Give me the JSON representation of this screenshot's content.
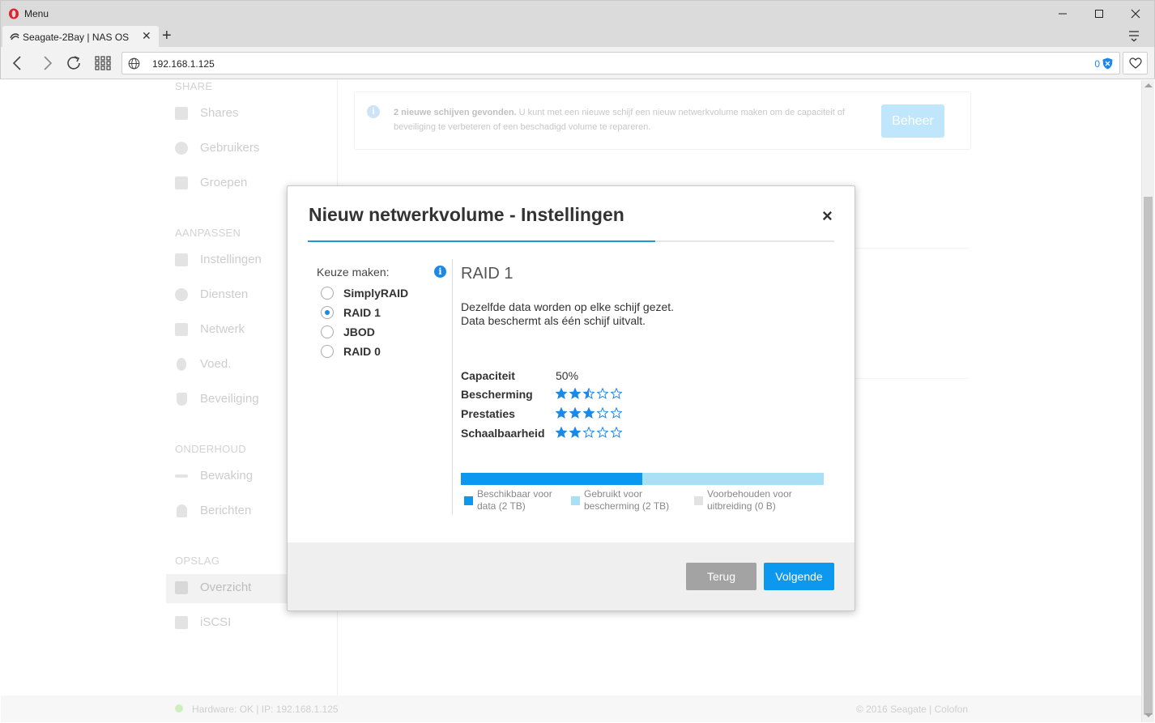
{
  "browser": {
    "menu_label": "Menu",
    "tab_title": "Seagate-2Bay | NAS OS",
    "url": "192.168.1.125",
    "adblock_count": "0"
  },
  "sidebar": {
    "top_section_label": "SHARE",
    "sections": [
      {
        "heading": "",
        "items": [
          {
            "label": "Shares",
            "icon": "folder-icon"
          },
          {
            "label": "Gebruikers",
            "icon": "user-icon"
          },
          {
            "label": "Groepen",
            "icon": "group-icon"
          }
        ]
      },
      {
        "heading": "AANPASSEN",
        "items": [
          {
            "label": "Instellingen",
            "icon": "wrench-icon"
          },
          {
            "label": "Diensten",
            "icon": "gear-icon"
          },
          {
            "label": "Netwerk",
            "icon": "network-icon"
          },
          {
            "label": "Voed.",
            "icon": "bulb-icon"
          },
          {
            "label": "Beveiliging",
            "icon": "shield-icon"
          }
        ]
      },
      {
        "heading": "ONDERHOUD",
        "items": [
          {
            "label": "Bewaking",
            "icon": "pulse-icon"
          },
          {
            "label": "Berichten",
            "icon": "bell-icon"
          }
        ]
      },
      {
        "heading": "OPSLAG",
        "items": [
          {
            "label": "Overzicht",
            "icon": "storage-icon",
            "active": true
          },
          {
            "label": "iSCSI",
            "icon": "iscsi-icon"
          }
        ]
      }
    ]
  },
  "notice": {
    "bold": "2 nieuwe schijven gevonden.",
    "text": " U kunt met een nieuwe schijf een nieuw netwerkvolume maken om de capaciteit of beveiliging te verbeteren of een beschadigd volume te repareren.",
    "button": "Beheer"
  },
  "footer": {
    "status": "Hardware: OK  |  IP: 192.168.1.125",
    "copyright": "© 2016 Seagate | Colofon"
  },
  "modal": {
    "title": "Nieuw netwerkvolume - Instellingen",
    "close": "×",
    "step_progress": 0.66,
    "choose_label": "Keuze maken:",
    "info_glyph": "i",
    "options": [
      {
        "label": "SimplyRAID",
        "selected": false
      },
      {
        "label": "RAID 1",
        "selected": true
      },
      {
        "label": "JBOD",
        "selected": false
      },
      {
        "label": "RAID 0",
        "selected": false
      }
    ],
    "detail": {
      "title": "RAID 1",
      "description_line1": "Dezelfde data worden op elke schijf gezet.",
      "description_line2": "Data beschermt als één schijf uitvalt.",
      "capacity_label": "Capaciteit",
      "capacity_value": "50%",
      "ratings": [
        {
          "label": "Bescherming",
          "stars": 2.5,
          "max": 5
        },
        {
          "label": "Prestaties",
          "stars": 3,
          "max": 5
        },
        {
          "label": "Schaalbaarheid",
          "stars": 2,
          "max": 5
        }
      ],
      "capacity_bar": {
        "available_fraction": 0.5,
        "protection_fraction": 0.5,
        "reserved_fraction": 0.0
      },
      "legend": [
        {
          "line1": "Beschikbaar voor",
          "line2": "data (2 TB)",
          "color": "#0d98f0"
        },
        {
          "line1": "Gebruikt voor",
          "line2": "bescherming (2 TB)",
          "color": "#a9e0f6"
        },
        {
          "line1": "Voorbehouden voor",
          "line2": "uitbreiding (0 B)",
          "color": "#e2e2e2"
        }
      ]
    },
    "buttons": {
      "back": "Terug",
      "next": "Volgende"
    }
  },
  "colors": {
    "accent": "#0d98f0",
    "star": "#1e88e5",
    "protection": "#a9e0f6"
  }
}
